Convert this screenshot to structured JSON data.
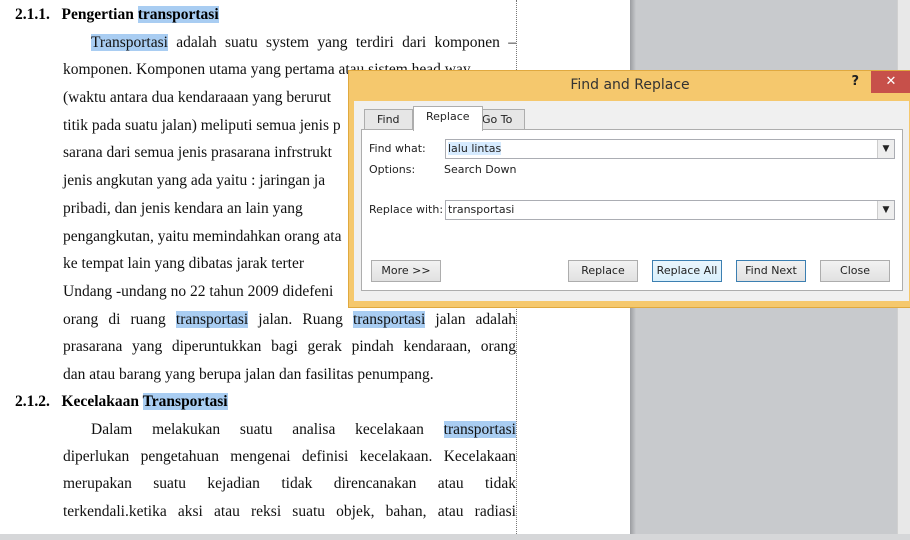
{
  "document": {
    "heading1": {
      "number": "2.1.1.",
      "text": "Pengertian ",
      "highlight": "transportasi"
    },
    "lines1": [
      {
        "hl": "Transportasi",
        "rest": " adalah suatu system yang terdiri dari komponen –"
      },
      {
        "text": "komponen. Komponen utama yang pertama atau sistem head way"
      },
      {
        "text": "(waktu antara dua kendaraaan yang berurut"
      },
      {
        "text": "titik pada suatu jalan) meliputi semua jenis p"
      },
      {
        "text": "sarana dari semua jenis prasarana infrstrukt"
      },
      {
        "text": "jenis angkutan yang ada yaitu : jaringan ja"
      },
      {
        "text": "pribadi, dan jenis kendara an lain yang"
      },
      {
        "text": "pengangkutan, yaitu memindahkan orang ata"
      },
      {
        "text": "ke tempat lain yang dibatas jarak terter"
      },
      {
        "text": "Undang -undang  no 22 tahun 2009 didefeni"
      }
    ],
    "line11": {
      "a": "orang di ruang ",
      "hl1": "transportasi",
      "b": " jalan. Ruang ",
      "hl2": "transportasi",
      "c": " jalan adalah"
    },
    "line12": "prasarana  yang diperuntukkan bagi gerak pindah kendaraan, orang",
    "line13": "dan atau barang  yang berupa jalan dan fasilitas penumpang.",
    "heading2": {
      "number": "2.1.2.",
      "text": "Kecelakaan ",
      "highlight": "Transportasi"
    },
    "line14": {
      "a": "Dalam melakukan suatu analisa kecelakaan ",
      "hl": "transportasi"
    },
    "lines2": [
      "diperlukan pengetahuan mengenai definisi kecelakaan. Kecelakaan",
      "merupakan suatu kejadian tidak direncanakan atau tidak",
      "terkendali.ketika aksi atau reksi suatu objek, bahan, atau radiasi"
    ]
  },
  "dialog": {
    "title": "Find and Replace",
    "help": "?",
    "close": "✕",
    "tabs": [
      "Find",
      "Replace",
      "Go To"
    ],
    "active_tab": "Replace",
    "find_label": "Find what:",
    "find_value": "lalu lintas",
    "options_label": "Options:",
    "options_value": "Search Down",
    "replace_label": "Replace with:",
    "replace_value": "transportasi",
    "buttons": {
      "more": "More >>",
      "replace": "Replace",
      "replace_all": "Replace All",
      "find_next": "Find Next",
      "close": "Close"
    }
  },
  "colors": {
    "highlight": "#a9cdf2",
    "dialog_frame": "#f5c86d",
    "close_button": "#c7504a"
  }
}
